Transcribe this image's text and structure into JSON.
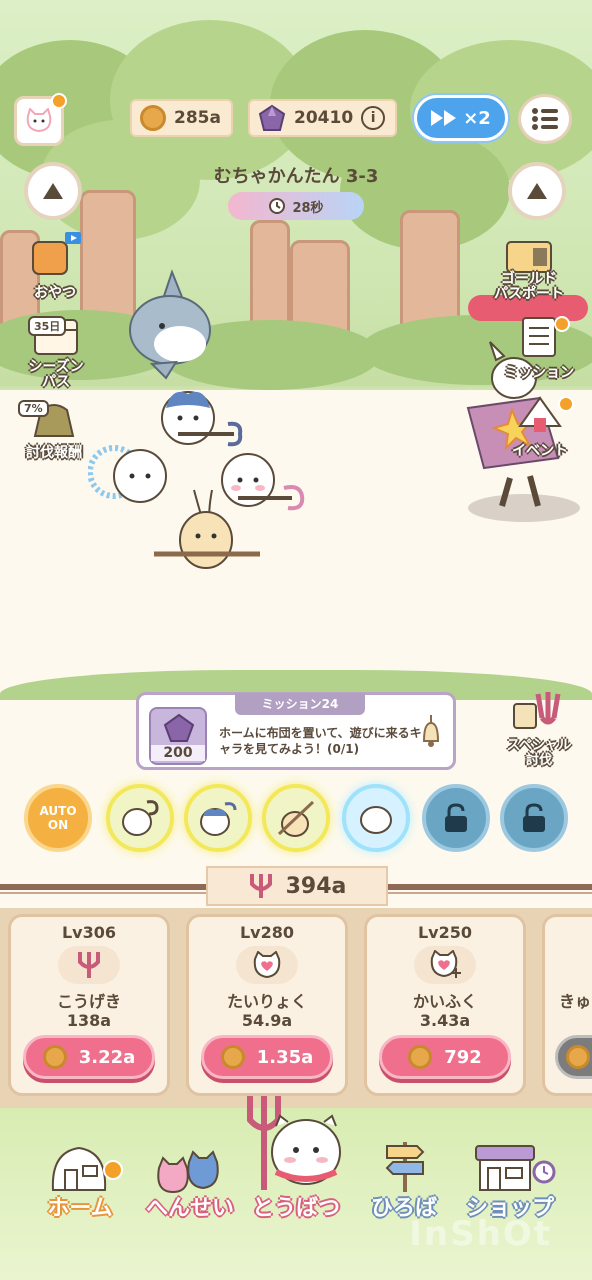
{
  "hud": {
    "coins": "285a",
    "gems": "20410",
    "speed_label": "×2",
    "stage_title": "むちゃかんたん 3-3",
    "timer": "28秒"
  },
  "side_left": {
    "snack_label": "おやつ",
    "season_days": "35日",
    "season_label": "シーズン\nパス",
    "reward_percent": "7%",
    "reward_label": "討伐報酬"
  },
  "side_right": {
    "gold_label": "ゴールド\nパスポート",
    "mission_label": "ミッション",
    "event_label": "イベント"
  },
  "mission": {
    "title": "ミッション24",
    "reward": "200",
    "text": "ホームに布団を置いて、遊びに来るキャラを見てみよう！(0/1)"
  },
  "special_label": "スペシャル\n討伐",
  "skills": {
    "auto_label": "AUTO\nON"
  },
  "upgrade_currency": "394a",
  "cards": [
    {
      "level": "Lv306",
      "name": "こうげき",
      "value": "138a",
      "cost": "3.22a",
      "icon": "pitchfork-icon"
    },
    {
      "level": "Lv280",
      "name": "たいりょく",
      "value": "54.9a",
      "cost": "1.35a",
      "icon": "heart-icon"
    },
    {
      "level": "Lv250",
      "name": "かいふく",
      "value": "3.43a",
      "cost": "792",
      "icon": "heal-icon"
    },
    {
      "level": "",
      "name": "きゅ",
      "value": "",
      "cost": "",
      "icon": "partial-card"
    }
  ],
  "nav": [
    {
      "label": "ホーム",
      "icon": "home-icon"
    },
    {
      "label": "へんせい",
      "icon": "team-icon"
    },
    {
      "label": "とうばつ",
      "icon": "battle-icon"
    },
    {
      "label": "ひろば",
      "icon": "signpost-icon"
    },
    {
      "label": "ショップ",
      "icon": "shop-icon"
    }
  ],
  "watermark": "InShOt",
  "colors": {
    "accent_pink": "#ef6f8c",
    "speed_blue": "#4da3ec",
    "coin_gold": "#e6a84a",
    "gem_purple": "#8a66a8"
  }
}
